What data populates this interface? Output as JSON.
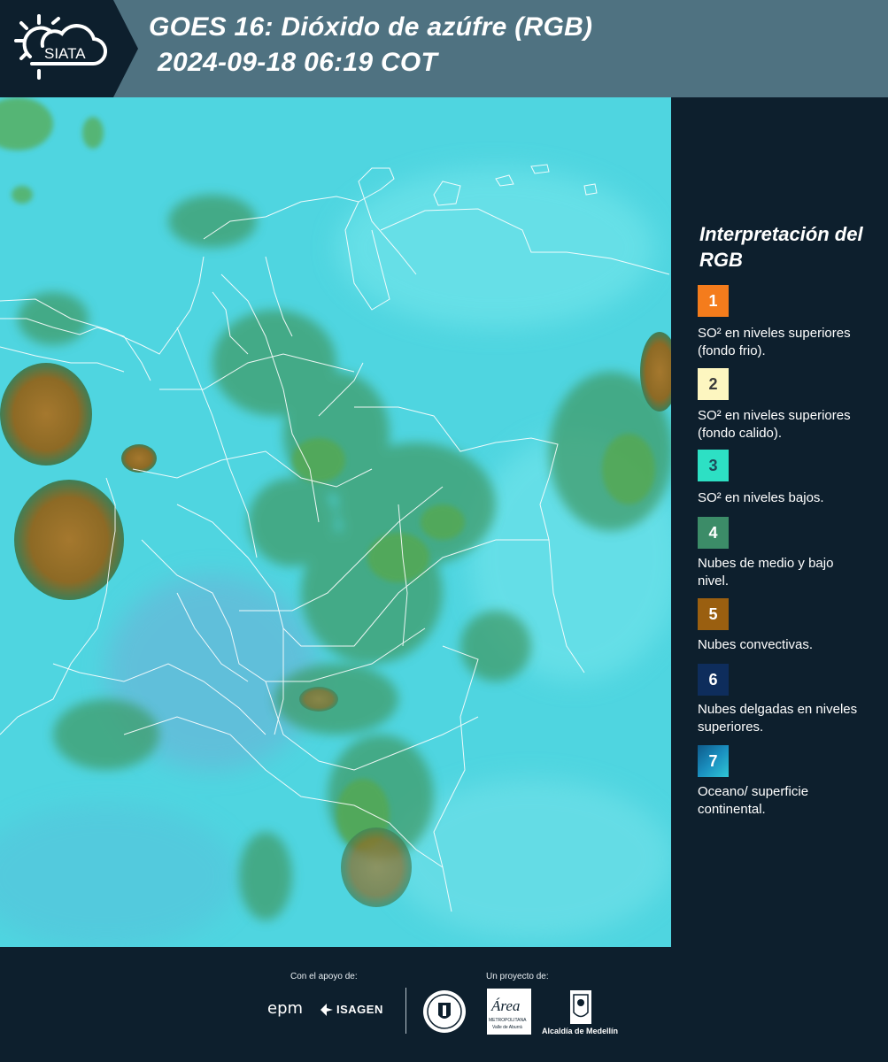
{
  "header": {
    "logo_text": "SIATA",
    "title_line1": "GOES 16: Dióxido de azúfre (RGB)",
    "title_line2": "2024-09-18 06:19 COT"
  },
  "legend": {
    "title": "Interpretación del RGB",
    "items": [
      {
        "number": "1",
        "color": "#f47c1c",
        "text_color": "#ffffff",
        "label": "SO² en niveles superiores (fondo frio)."
      },
      {
        "number": "2",
        "color": "#fdf6c0",
        "text_color": "#3a3a3a",
        "label": "SO² en niveles superiores (fondo calido)."
      },
      {
        "number": "3",
        "color": "#2de0c4",
        "text_color": "#1d4b5a",
        "label": "SO² en niveles bajos."
      },
      {
        "number": "4",
        "color": "#3c8c68",
        "text_color": "#ffffff",
        "label": "Nubes de medio y bajo nivel."
      },
      {
        "number": "5",
        "color": "#9a5f10",
        "text_color": "#ffffff",
        "label": "Nubes convectivas."
      },
      {
        "number": "6",
        "color": "#0e2d5c",
        "text_color": "#ffffff",
        "label": "Nubes delgadas en niveles superiores."
      },
      {
        "number": "7",
        "color": "#1a8fbf",
        "text_color": "#ffffff",
        "label": "Oceano/ superficie continental."
      }
    ]
  },
  "footer": {
    "support_label": "Con el apoyo de:",
    "project_label": "Un proyecto de:",
    "sponsor_1": "epm",
    "sponsor_2": "ISAGEN",
    "partner_area": "Área",
    "partner_area_sub": "METROPOLITANA",
    "partner_area_sub2": "Valle de Aburrá",
    "partner_alcaldia": "Alcaldía de Medellín"
  },
  "colors": {
    "background": "#0d1f2d",
    "header_band": "#4f7281",
    "map_base": "#4fd7e2"
  }
}
